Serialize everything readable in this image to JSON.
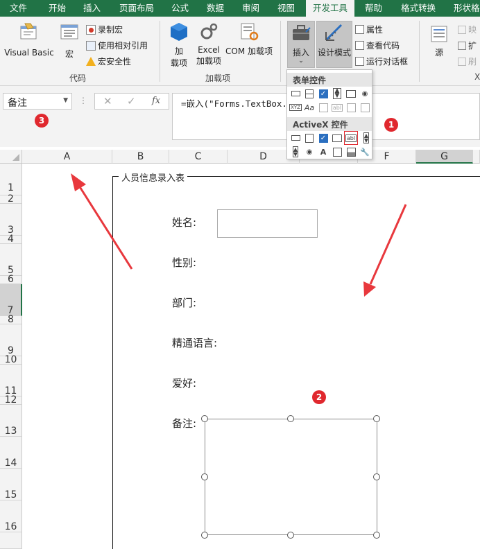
{
  "tabs": [
    "文件",
    "开始",
    "插入",
    "页面布局",
    "公式",
    "数据",
    "审阅",
    "视图",
    "开发工具",
    "帮助",
    "格式转换",
    "形状格"
  ],
  "active_tab": "开发工具",
  "ribbon": {
    "visual_basic": "Visual Basic",
    "macros": "宏",
    "record_macro": "录制宏",
    "relative_ref": "使用相对引用",
    "macro_security": "宏安全性",
    "group_code": "代码",
    "addins_line1": "加",
    "addins_line2": "载项",
    "excel_addins_line1": "Excel",
    "excel_addins_line2": "加载项",
    "com_addins": "COM 加载项",
    "group_addins": "加载项",
    "insert": "插入",
    "design_mode": "设计模式",
    "properties": "属性",
    "view_code": "查看代码",
    "run_dialog": "运行对话框",
    "source": "源",
    "map_props": "映",
    "expand": "扩",
    "refresh": "刷",
    "x_label": "X"
  },
  "dropdown": {
    "form_controls": "表单控件",
    "activex_controls": "ActiveX 控件"
  },
  "formula_bar": {
    "name_box": "备注",
    "fx": "fx",
    "formula": "=嵌入(\"Forms.TextBox.1\""
  },
  "columns": [
    "A",
    "B",
    "C",
    "D",
    "E",
    "F",
    "G"
  ],
  "rows": [
    "1",
    "2",
    "3",
    "4",
    "5",
    "6",
    "7",
    "8",
    "9",
    "10",
    "11",
    "12",
    "13",
    "14",
    "15",
    "16"
  ],
  "form": {
    "title": "人员信息录入表",
    "name_label": "姓名:",
    "gender_label": "性别:",
    "dept_label": "部门:",
    "lang_label": "精通语言:",
    "hobby_label": "爱好:",
    "note_label": "备注:"
  },
  "badges": [
    "1",
    "2",
    "3"
  ],
  "colors": {
    "excel_green": "#217346",
    "badge_red": "#e0282e",
    "arrow_red": "#e8383d"
  }
}
